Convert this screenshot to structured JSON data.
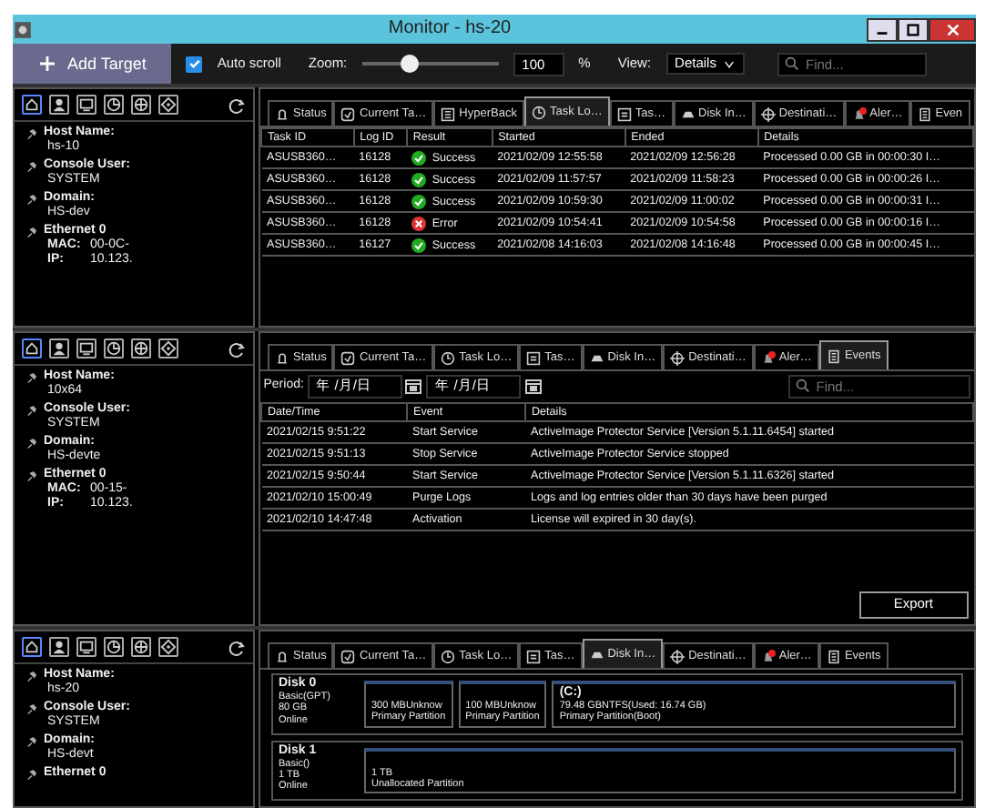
{
  "window": {
    "title": "Monitor - hs-20"
  },
  "toolbar": {
    "add_button": "Add Target",
    "auto_scroll": {
      "label": "Auto scroll",
      "checked": true
    },
    "zoom": {
      "label": "Zoom:",
      "level": 0.35,
      "value": "100",
      "unit": "%"
    },
    "view": {
      "label": "View:",
      "value": "Details"
    },
    "search": {
      "placeholder": "Find..."
    }
  },
  "panels": [
    {
      "info": [
        {
          "label": "Host Name:",
          "value": "hs-10"
        },
        {
          "label": "Console User:",
          "value": "SYSTEM"
        },
        {
          "label": "Domain:",
          "value": "HS-dev"
        },
        {
          "label": "Ethernet 0"
        }
      ],
      "net": [
        {
          "label": "MAC:",
          "value": "00-0C-"
        },
        {
          "label": "IP:",
          "value": "10.123."
        }
      ],
      "tabs": [
        {
          "kind": "status",
          "label": "Status",
          "selected": false
        },
        {
          "kind": "task",
          "label": "Current Ta…",
          "selected": false
        },
        {
          "kind": "hyperback",
          "label": "HyperBack",
          "selected": false
        },
        {
          "kind": "log",
          "label": "Task Lo…",
          "selected": true
        },
        {
          "kind": "list",
          "label": "Tas…",
          "selected": false
        },
        {
          "kind": "disk",
          "label": "Disk In…",
          "selected": false
        },
        {
          "kind": "destination",
          "label": "Destinati…",
          "selected": false
        },
        {
          "kind": "alert",
          "label": "Aler…",
          "selected": false
        },
        {
          "kind": "event",
          "label": "Even",
          "selected": false
        }
      ],
      "content": {
        "kind": "tasklog",
        "columns": [
          "Task ID",
          "Log ID",
          "Result",
          "Started",
          "Ended",
          "Details"
        ],
        "rows": [
          {
            "cells": [
              "ASUSB360…",
              "16128",
              "Success",
              "2021/02/09 12:55:58",
              "2021/02/09 12:56:28",
              "Processed 0.00 GB in 00:00:30 I…"
            ],
            "kind": "success"
          },
          {
            "cells": [
              "ASUSB360…",
              "16128",
              "Success",
              "2021/02/09 11:57:57",
              "2021/02/09 11:58:23",
              "Processed 0.00 GB in 00:00:26 I…"
            ],
            "kind": "success"
          },
          {
            "cells": [
              "ASUSB360…",
              "16128",
              "Success",
              "2021/02/09 10:59:30",
              "2021/02/09 11:00:02",
              "Processed 0.00 GB in 00:00:31 I…"
            ],
            "kind": "success"
          },
          {
            "cells": [
              "ASUSB360…",
              "16128",
              "Error",
              "2021/02/09 10:54:41",
              "2021/02/09 10:54:58",
              "Processed 0.00 GB in 00:00:16 I…"
            ],
            "kind": "error"
          },
          {
            "cells": [
              "ASUSB360…",
              "16127",
              "Success",
              "2021/02/08 14:16:03",
              "2021/02/08 14:16:48",
              "Processed 0.00 GB in 00:00:45 I…"
            ],
            "kind": "success"
          }
        ]
      }
    },
    {
      "info": [
        {
          "label": "Host Name:",
          "value": "10x64"
        },
        {
          "label": "Console User:",
          "value": "SYSTEM"
        },
        {
          "label": "Domain:",
          "value": "HS-devte"
        },
        {
          "label": "Ethernet 0"
        }
      ],
      "net": [
        {
          "label": "MAC:",
          "value": "00-15-"
        },
        {
          "label": "IP:",
          "value": "10.123."
        }
      ],
      "tabs": [
        {
          "kind": "status",
          "label": "Status",
          "selected": false
        },
        {
          "kind": "task",
          "label": "Current Ta…",
          "selected": false
        },
        {
          "kind": "log",
          "label": "Task Lo…",
          "selected": false
        },
        {
          "kind": "list",
          "label": "Tas…",
          "selected": false
        },
        {
          "kind": "disk",
          "label": "Disk In…",
          "selected": false
        },
        {
          "kind": "destination",
          "label": "Destinati…",
          "selected": false
        },
        {
          "kind": "alert",
          "label": "Aler…",
          "selected": false
        },
        {
          "kind": "event",
          "label": "Events",
          "selected": true
        }
      ],
      "content": {
        "kind": "events",
        "period": "Period:",
        "dates": [
          "年 /月/日",
          "年 /月/日"
        ],
        "search": {
          "placeholder": "Find..."
        },
        "columns": [
          "Date/Time",
          "Event",
          "Details"
        ],
        "rows": [
          {
            "cells": [
              "2021/02/15 9:51:22",
              "Start Service",
              "ActiveImage Protector Service [Version 5.1.11.6454] started"
            ]
          },
          {
            "cells": [
              "2021/02/15 9:51:13",
              "Stop Service",
              "ActiveImage Protector Service stopped"
            ]
          },
          {
            "cells": [
              "2021/02/15 9:50:44",
              "Start Service",
              "ActiveImage Protector Service [Version 5.1.11.6326] started"
            ]
          },
          {
            "cells": [
              "2021/02/10 15:00:49",
              "Purge Logs",
              "Logs and log entries older than 30 days have been purged"
            ]
          },
          {
            "cells": [
              "2021/02/10 14:47:48",
              "Activation",
              "License will expired in 30 day(s)."
            ]
          }
        ],
        "export": "Export"
      }
    },
    {
      "info": [
        {
          "label": "Host Name:",
          "value": "hs-20"
        },
        {
          "label": "Console User:",
          "value": "SYSTEM"
        },
        {
          "label": "Domain:",
          "value": "HS-devt"
        },
        {
          "label": "Ethernet 0"
        }
      ],
      "tabs": [
        {
          "kind": "status",
          "label": "Status",
          "selected": false
        },
        {
          "kind": "task",
          "label": "Current Ta…",
          "selected": false
        },
        {
          "kind": "log",
          "label": "Task Lo…",
          "selected": false
        },
        {
          "kind": "list",
          "label": "Tas…",
          "selected": false
        },
        {
          "kind": "disk",
          "label": "Disk In…",
          "selected": true
        },
        {
          "kind": "destination",
          "label": "Destinati…",
          "selected": false
        },
        {
          "kind": "alert",
          "label": "Aler…",
          "selected": false
        },
        {
          "kind": "event",
          "label": "Events",
          "selected": false
        }
      ],
      "content": {
        "kind": "disks",
        "disks": [
          {
            "name": "Disk 0",
            "type": "Basic(GPT)",
            "size": "80 GB",
            "state": "Online",
            "partitions": [
              {
                "size": "300 MBUnknow",
                "type": "Primary Partition"
              },
              {
                "size": "100 MBUnknow",
                "type": "Primary Partition"
              },
              {
                "name": "(C:)",
                "size": "79.48 GBNTFS(Used: 16.74 GB)",
                "type": "Primary Partition(Boot)"
              }
            ]
          },
          {
            "name": "Disk 1",
            "type": "Basic()",
            "size": "1 TB",
            "state": "Online",
            "partitions": [
              {
                "size": "1 TB",
                "type": "Unallocated Partition"
              }
            ]
          }
        ]
      }
    }
  ]
}
